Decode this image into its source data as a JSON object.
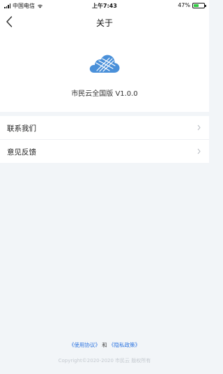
{
  "status_bar": {
    "carrier": "中国电信",
    "time": "上午7:43",
    "battery_percent": "47%",
    "battery_level": 0.47,
    "wifi_icon": "wifi-icon",
    "signal_icon": "signal-icon"
  },
  "nav": {
    "title": "关于",
    "back_icon": "chevron-left-icon"
  },
  "app": {
    "name_version": "市民云全国版 V1.0.0",
    "logo_icon": "cloud-logo-icon"
  },
  "menu": {
    "items": [
      {
        "label": "联系我们"
      },
      {
        "label": "意见反馈"
      }
    ]
  },
  "footer": {
    "user_agreement": "《使用协议》",
    "and_text": "和",
    "privacy_policy": "《隐私政策》",
    "copyright": "Copyright©2020-2020 市民云 版权所有"
  },
  "colors": {
    "accent": "#2d74e0",
    "logo_blue": "#4a90d9",
    "page_bg": "#f2f5f8"
  }
}
